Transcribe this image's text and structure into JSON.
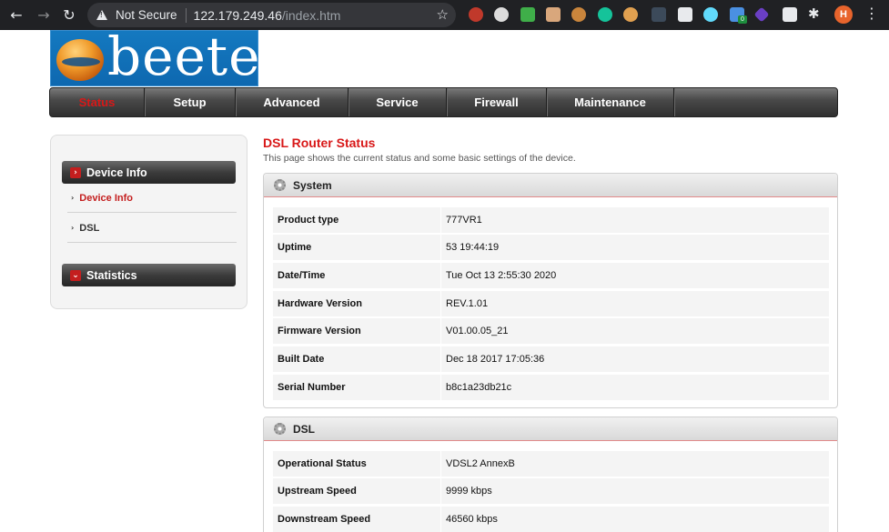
{
  "browser": {
    "security_label": "Not Secure",
    "url_host": "122.179.249.46",
    "url_path": "/index.htm",
    "profile_initial": "H",
    "extension_badge": "0"
  },
  "logo": {
    "text": "beetel"
  },
  "topnav": {
    "items": [
      {
        "label": "Status",
        "active": true
      },
      {
        "label": "Setup"
      },
      {
        "label": "Advanced"
      },
      {
        "label": "Service"
      },
      {
        "label": "Firewall"
      },
      {
        "label": "Maintenance"
      },
      {
        "label": ""
      }
    ]
  },
  "sidebar": {
    "section1": "Device Info",
    "items": [
      {
        "label": "Device Info",
        "active": true
      },
      {
        "label": "DSL"
      }
    ],
    "section2": "Statistics"
  },
  "main": {
    "title": "DSL Router Status",
    "description": "This page shows the current status and some basic settings of the device."
  },
  "system": {
    "title": "System",
    "rows": [
      {
        "key": "Product type",
        "value": "777VR1"
      },
      {
        "key": "Uptime",
        "value": "53 19:44:19"
      },
      {
        "key": "Date/Time",
        "value": "Tue Oct 13 2:55:30 2020"
      },
      {
        "key": "Hardware Version",
        "value": "REV.1.01"
      },
      {
        "key": "Firmware Version",
        "value": "V01.00.05_21"
      },
      {
        "key": "Built Date",
        "value": "Dec 18 2017 17:05:36"
      },
      {
        "key": "Serial Number",
        "value": "b8c1a23db21c"
      }
    ]
  },
  "dsl": {
    "title": "DSL",
    "rows": [
      {
        "key": "Operational Status",
        "value": "VDSL2 AnnexB"
      },
      {
        "key": "Upstream Speed",
        "value": "9999 kbps"
      },
      {
        "key": "Downstream Speed",
        "value": "46560 kbps"
      }
    ]
  },
  "colors": {
    "accent_red": "#d81818",
    "nav_dark": "#2f2f2f",
    "logo_blue": "#1479c0"
  }
}
